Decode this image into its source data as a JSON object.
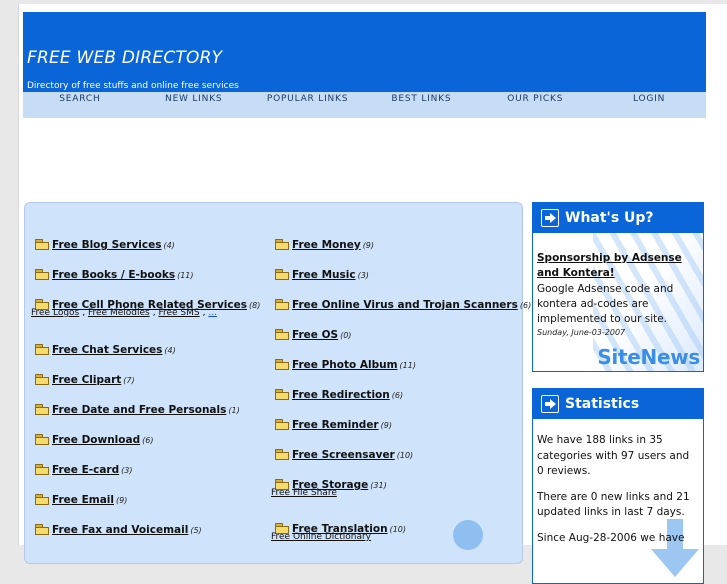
{
  "site": {
    "title": "FREE WEB DIRECTORY",
    "tagline": "Directory of free stuffs and online free services"
  },
  "nav": {
    "items": [
      "SEARCH",
      "NEW LINKS",
      "POPULAR LINKS",
      "BEST LINKS",
      "OUR PICKS",
      "LOGIN"
    ]
  },
  "categories": {
    "left": [
      {
        "name": "Free Blog Services",
        "count": "(4)"
      },
      {
        "name": "Free Books / E-books",
        "count": "(11)"
      },
      {
        "name": "Free Cell Phone Related Services",
        "count": "(8)",
        "subs": [
          "Free Logos",
          "Free Melodies",
          "Free SMS",
          "..."
        ]
      },
      {
        "name": "Free Chat Services",
        "count": "(4)"
      },
      {
        "name": "Free Clipart",
        "count": "(7)"
      },
      {
        "name": "Free Date and Free Personals",
        "count": "(1)"
      },
      {
        "name": "Free Download",
        "count": "(6)"
      },
      {
        "name": "Free E-card",
        "count": "(3)"
      },
      {
        "name": "Free Email",
        "count": "(9)"
      },
      {
        "name": "Free Fax and Voicemail",
        "count": "(5)"
      }
    ],
    "right": [
      {
        "name": "Free Money",
        "count": "(9)"
      },
      {
        "name": "Free Music",
        "count": "(3)"
      },
      {
        "name": "Free Online Virus and Trojan Scanners",
        "count": "(6)"
      },
      {
        "name": "Free OS",
        "count": "(0)"
      },
      {
        "name": "Free Photo Album",
        "count": "(11)"
      },
      {
        "name": "Free Redirection",
        "count": "(6)"
      },
      {
        "name": "Free Reminder",
        "count": "(9)"
      },
      {
        "name": "Free Screensaver",
        "count": "(10)"
      },
      {
        "name": "Free Storage",
        "count": "(31)",
        "subs": [
          "Free File Share"
        ]
      },
      {
        "name": "Free Translation",
        "count": "(10)",
        "subs": [
          "Free Online Dictionary"
        ]
      }
    ]
  },
  "whats_up": {
    "heading": "What's Up?",
    "news_title": "Sponsorship by Adsense and Kontera!",
    "news_text": "Google Adsense code and kontera ad-codes are implemented to our site.",
    "news_date": "Sunday, June-03-2007",
    "logo_text": "SiteNews"
  },
  "statistics": {
    "heading": "Statistics",
    "p1": "We have 188 links in 35 categories with 97 users and 0 reviews.",
    "p2": "There are 0 new links and 21 updated links in last 7 days.",
    "p3": "Since Aug-28-2006 we have"
  },
  "colors": {
    "header_blue": "#0a66d8",
    "nav_bg": "#c7ddf5",
    "panel_bg": "#cfe3fa"
  }
}
